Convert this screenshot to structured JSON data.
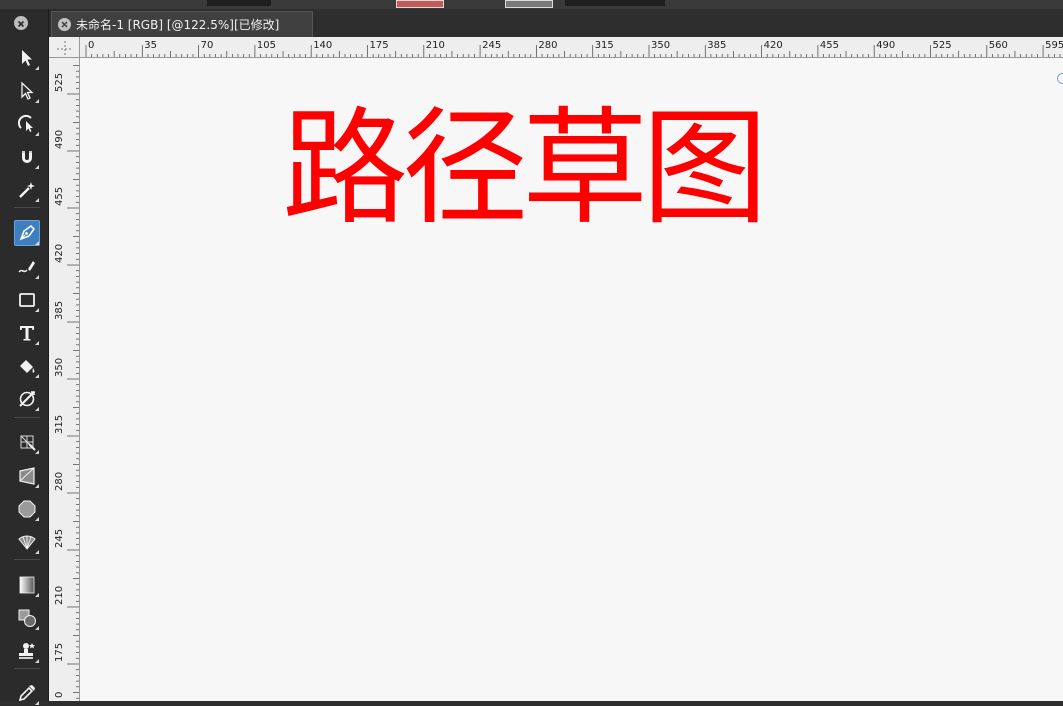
{
  "document_tab": {
    "title": "未命名-1 [RGB] [@122.5%][已修改]"
  },
  "canvas": {
    "text": "路径草图",
    "text_color": "#ff0000"
  },
  "rulers": {
    "horizontal_labels": [
      "0",
      "35",
      "70",
      "105",
      "140",
      "175",
      "210",
      "245",
      "280",
      "315",
      "350",
      "385",
      "420",
      "455",
      "490",
      "525",
      "560",
      "595"
    ],
    "vertical_labels": [
      "525",
      "490",
      "455",
      "420",
      "385",
      "350",
      "315",
      "280",
      "245",
      "210",
      "175",
      "0"
    ]
  },
  "tools": [
    {
      "name": "selection-tool",
      "icon": "arrow-icon"
    },
    {
      "name": "node-tool",
      "icon": "white-arrow-icon"
    },
    {
      "name": "rotate-tool",
      "icon": "rotate-arrow-icon"
    },
    {
      "name": "magnet-tool",
      "icon": "magnet-icon"
    },
    {
      "name": "magic-wand-tool",
      "icon": "magic-wand-icon"
    },
    {
      "name": "pen-tool",
      "icon": "pen-icon",
      "active": true
    },
    {
      "name": "pencil-tool",
      "icon": "pencil-icon"
    },
    {
      "name": "rectangle-tool",
      "icon": "rectangle-icon"
    },
    {
      "name": "type-tool",
      "icon": "text-t-icon"
    },
    {
      "name": "fill-tool",
      "icon": "paint-bucket-icon"
    },
    {
      "name": "transparency-tool",
      "icon": "transparency-icon"
    },
    {
      "name": "mesh-tool",
      "icon": "mesh-icon"
    },
    {
      "name": "perspective-tool",
      "icon": "perspective-icon"
    },
    {
      "name": "shape-tool",
      "icon": "polygon-icon"
    },
    {
      "name": "symbol-sprayer-tool",
      "icon": "fan-icon"
    },
    {
      "name": "gradient-tool",
      "icon": "gradient-icon"
    },
    {
      "name": "blend-tool",
      "icon": "blend-icon"
    },
    {
      "name": "stamp-tool",
      "icon": "stamp-icon"
    },
    {
      "name": "eyedropper-tool",
      "icon": "eyedropper-icon"
    }
  ],
  "colors": {
    "tool_active": "#3f7fbf",
    "panel_bg": "#2b2b2b",
    "canvas_bg": "#f7f7f8"
  }
}
